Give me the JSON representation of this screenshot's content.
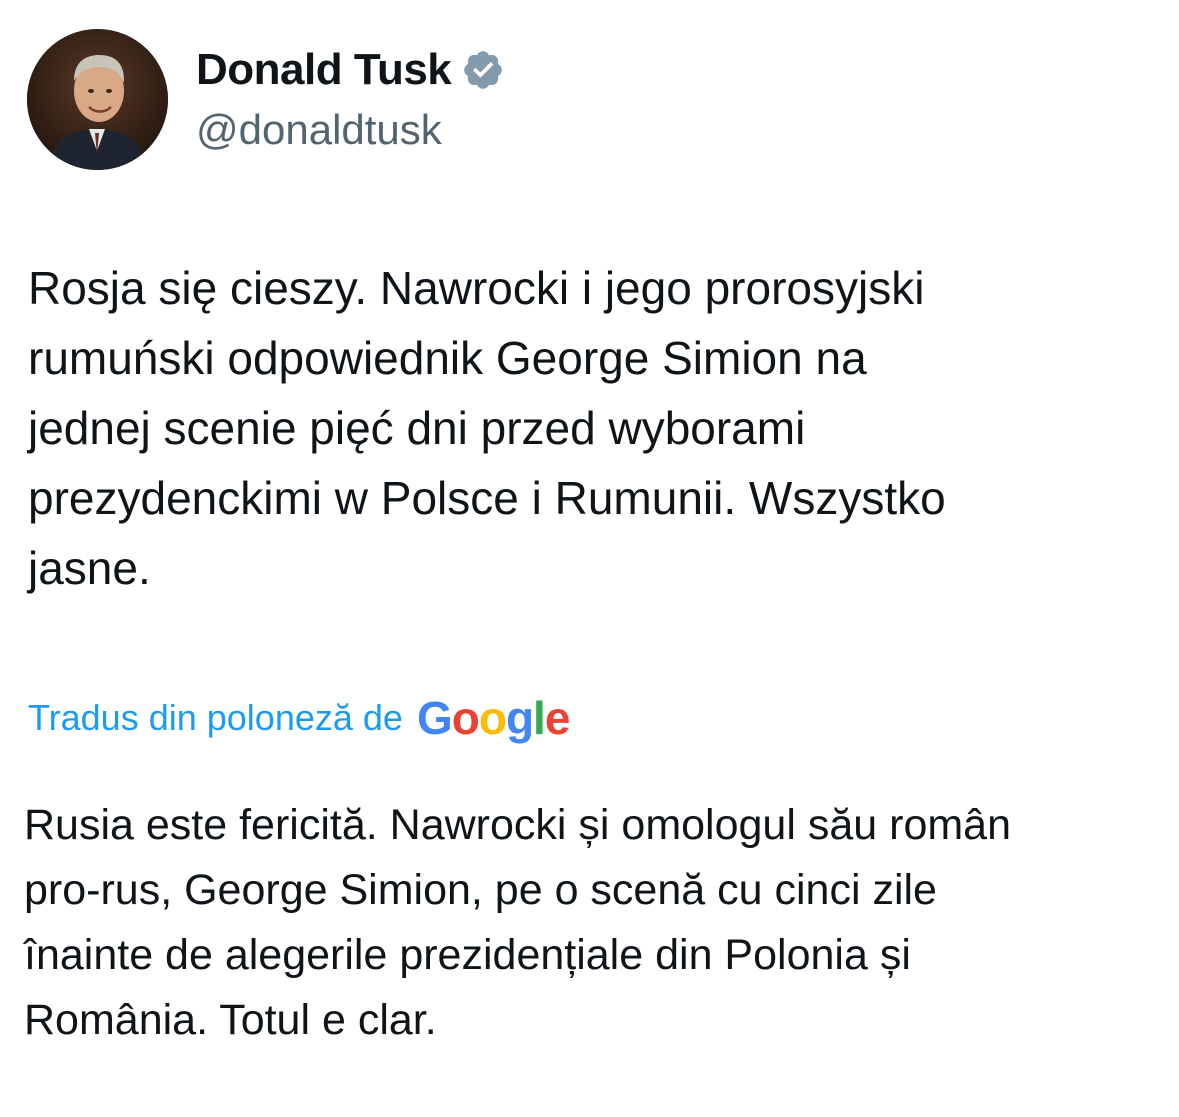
{
  "author": {
    "name": "Donald Tusk",
    "handle": "@donaldtusk",
    "verified_icon": "verified-badge-icon",
    "verified_color": "#829aab"
  },
  "tweet": {
    "lines": [
      "Rosja się cieszy. Nawrocki i jego prorosyjski",
      "rumuński odpowiednik George Simion na",
      "jednej scenie pięć dni przed wyborami",
      "prezydenckimi w Polsce i Rumunii. Wszystko",
      "jasne."
    ]
  },
  "translation": {
    "label": "Tradus din poloneză de",
    "provider": "Google",
    "link_color": "#1d9bf0",
    "provider_colors": [
      "#4285F4",
      "#EA4335",
      "#FBBC05",
      "#4285F4",
      "#34A853",
      "#EA4335"
    ],
    "lines": [
      "Rusia este fericită. Nawrocki și omologul său român",
      "pro-rus, George Simion, pe o scenă cu cinci zile",
      "înainte de alegerile prezidențiale din Polonia și",
      "România. Totul e clar."
    ]
  }
}
